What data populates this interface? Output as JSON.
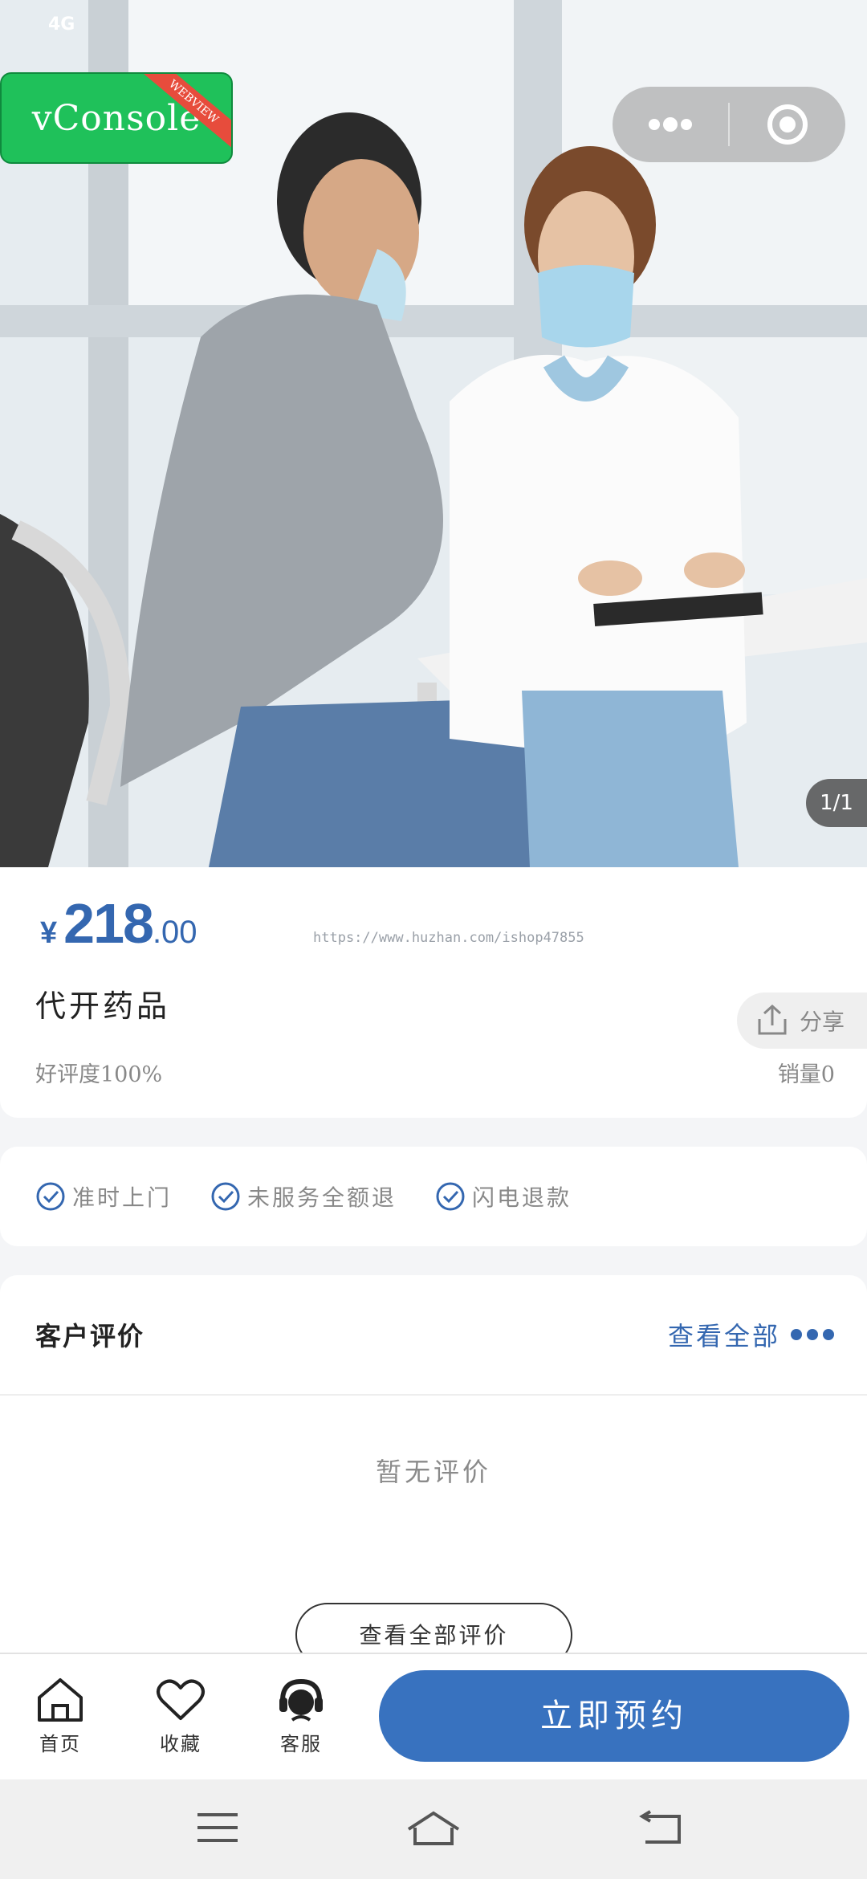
{
  "status_bar": {
    "network": "4G"
  },
  "vconsole": {
    "label": "vConsole",
    "ribbon": "WEBVIEW"
  },
  "mini_capsule": {
    "icons": [
      "more-dots-icon",
      "close-circle-icon"
    ]
  },
  "gallery": {
    "counter": "1/1"
  },
  "product": {
    "currency": "¥",
    "price_integer": "218",
    "price_decimal": ".00",
    "watermark": "https://www.huzhan.com/ishop47855",
    "title": "代开药品",
    "share_label": "分享",
    "rating": "好评度100%",
    "sales": "销量0"
  },
  "guarantees": [
    {
      "label": "准时上门"
    },
    {
      "label": "未服务全额退"
    },
    {
      "label": "闪电退款"
    }
  ],
  "reviews": {
    "title": "客户评价",
    "view_all": "查看全部",
    "empty_text": "暂无评价",
    "all_button": "查看全部评价"
  },
  "tabbar": {
    "home": "首页",
    "favorite": "收藏",
    "service": "客服",
    "book_button": "立即预约"
  },
  "colors": {
    "accent": "#3872bf",
    "price": "#3467b0",
    "vconsole": "#1fc15a"
  }
}
